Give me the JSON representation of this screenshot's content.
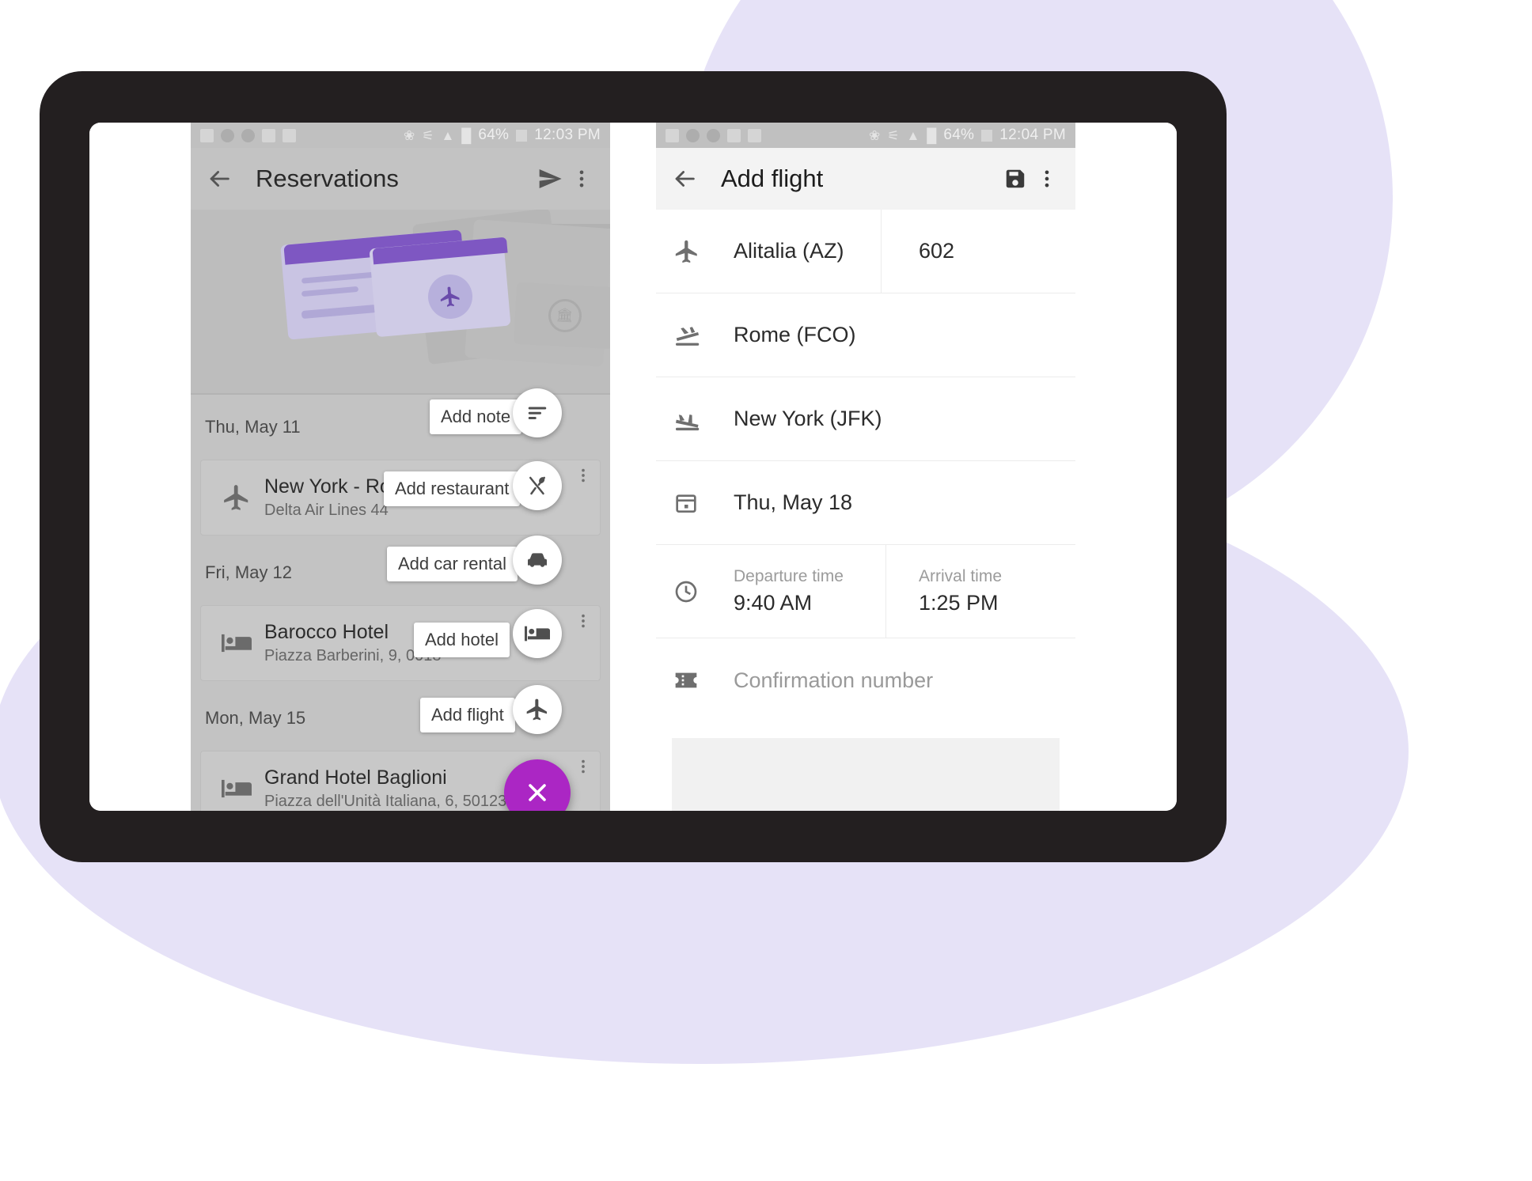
{
  "device": {
    "frame_color": "#231f20",
    "screen_color": "#ffffff",
    "accent_color": "#ab26c4",
    "blob_color": "#e6e2f7",
    "ticket_purple": "#7e57c2"
  },
  "left_phone": {
    "status_bar": {
      "battery": "64%",
      "time": "12:03 PM",
      "icons": [
        "image-icon",
        "sync-icon",
        "sync-icon",
        "document-icon",
        "windows-icon",
        "bluetooth-icon",
        "vibrate-off-icon",
        "wifi-icon",
        "signal-icon",
        "battery-icon"
      ]
    },
    "app_bar": {
      "back_icon": "back-arrow-icon",
      "title": "Reservations",
      "send_icon": "send-icon",
      "overflow_icon": "overflow-menu-icon"
    },
    "hero": {
      "illustration": "boarding-pass-illustration",
      "plane_icon": "airplane-icon",
      "stub_icon": "museum-icon"
    },
    "groups": [
      {
        "date": "Thu, May 11",
        "speed_dial": {
          "label": "Add note",
          "icon": "note-icon"
        },
        "items": [
          {
            "icon": "airplane-icon",
            "title": "New York - Rome",
            "subtitle": "Delta Air Lines 44",
            "overflow_icon": "overflow-menu-icon"
          }
        ]
      },
      {
        "date": "Fri, May 12",
        "speed_dial": {
          "label": "Add car rental",
          "icon": "car-icon"
        },
        "items": [
          {
            "icon": "hotel-bed-icon",
            "title": "Barocco Hotel",
            "subtitle": "Piazza Barberini, 9, 0018",
            "overflow_icon": "overflow-menu-icon"
          }
        ]
      },
      {
        "date": "Mon, May 15",
        "speed_dial": {
          "label": "Add flight",
          "icon": "airplane-icon"
        },
        "items": [
          {
            "icon": "hotel-bed-icon",
            "title": "Grand Hotel Baglioni",
            "subtitle": "Piazza dell'Unità Italiana, 6, 50123 Fire…",
            "overflow_icon": "overflow-menu-icon"
          }
        ]
      }
    ],
    "extra_speed_dials": [
      {
        "label": "Add restaurant",
        "icon": "restaurant-icon"
      },
      {
        "label": "Add hotel",
        "icon": "hotel-bed-icon"
      }
    ],
    "fab": {
      "icon": "close-icon",
      "color": "#ab26c4",
      "state": "expanded"
    }
  },
  "right_phone": {
    "status_bar": {
      "battery": "64%",
      "time": "12:04 PM",
      "icons": [
        "image-icon",
        "sync-icon",
        "sync-icon",
        "document-icon",
        "windows-icon",
        "bluetooth-icon",
        "vibrate-off-icon",
        "wifi-icon",
        "signal-icon",
        "battery-icon"
      ]
    },
    "app_bar": {
      "back_icon": "back-arrow-icon",
      "title": "Add flight",
      "save_icon": "save-icon",
      "overflow_icon": "overflow-menu-icon"
    },
    "form": {
      "airline": {
        "icon": "airplane-icon",
        "value": "Alitalia (AZ)"
      },
      "flight_number": {
        "value": "602"
      },
      "origin": {
        "icon": "flight-takeoff-icon",
        "value": "Rome (FCO)"
      },
      "destination": {
        "icon": "flight-land-icon",
        "value": "New York (JFK)"
      },
      "date": {
        "icon": "calendar-icon",
        "value": "Thu, May 18"
      },
      "times": {
        "icon": "clock-icon",
        "departure_label": "Departure time",
        "departure_value": "9:40 AM",
        "arrival_label": "Arrival time",
        "arrival_value": "1:25 PM"
      },
      "confirmation": {
        "icon": "ticket-icon",
        "placeholder": "Confirmation number",
        "value": ""
      },
      "notes_area": {
        "value": ""
      }
    }
  }
}
